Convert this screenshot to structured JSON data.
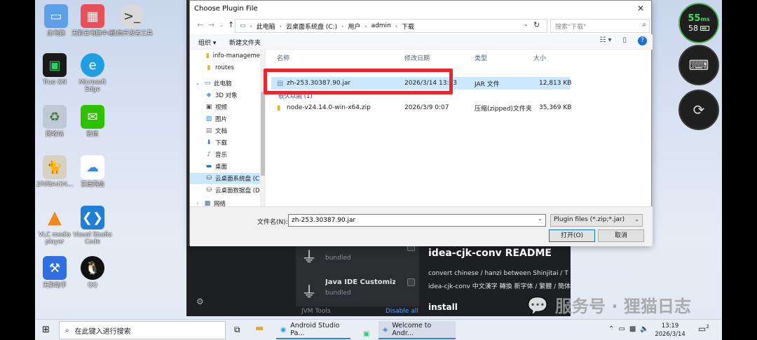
{
  "desktop_icons": [
    {
      "label": "此电脑",
      "icon": "computer-icon",
      "color": "#5da0e8"
    },
    {
      "label": "无影云电脑中心",
      "icon": "cloud-pc-icon",
      "color": "#e8505b"
    },
    {
      "label": "微信开发者工具",
      "icon": "wechat-devtools-icon",
      "color": "#d9d9d9"
    },
    {
      "label": "True ON",
      "icon": "true-on-icon",
      "color": "#1a1a1a"
    },
    {
      "label": "Microsoft Edge",
      "icon": "edge-icon",
      "color": "#1f9ee0"
    },
    {
      "label": "回收站",
      "icon": "recycle-bin-icon",
      "color": "#bfc9d6"
    },
    {
      "label": "微信",
      "icon": "wechat-icon",
      "color": "#2dc100"
    },
    {
      "label": "2f4f8A434...",
      "icon": "cat-image-icon",
      "color": "#d8d0c0"
    },
    {
      "label": "百度网盘",
      "icon": "baidu-netdisk-icon",
      "color": "#ffffff"
    },
    {
      "label": "VLC media player",
      "icon": "vlc-icon",
      "color": "#f08a1c"
    },
    {
      "label": "Visual Studio Code",
      "icon": "vscode-icon",
      "color": "#1f7fd4"
    },
    {
      "label": "无影助手",
      "icon": "wuying-assistant-icon",
      "color": "#2f6fe0"
    },
    {
      "label": "QQ",
      "icon": "qq-icon",
      "color": "#111111"
    }
  ],
  "overlay": {
    "latency": "55",
    "latency_unit": "ms",
    "battery": "58"
  },
  "ide": {
    "plugins": [
      {
        "name": "",
        "badge": "bundled"
      },
      {
        "name": "Java IDE Customizati...",
        "badge": "bundled"
      }
    ],
    "readme_title": "idea-cjk-conv README",
    "readme_line1": "convert chinese / hanzi between Shinjitai / T",
    "readme_line2": "idea-cjk-conv 中文漢字 轉換 新字体 / 繁體 / 簡体",
    "install_heading": "install",
    "group_label": "JVM Tools",
    "disable_all": "Disable all"
  },
  "dialog": {
    "title": "Choose Plugin File",
    "breadcrumb": [
      "此电脑",
      "云桌面系统盘 (C:)",
      "用户",
      "admin",
      "下载"
    ],
    "search_placeholder": "搜索\"下载\"",
    "toolbar": {
      "organize": "组织 ▾",
      "new_folder": "新建文件夹"
    },
    "nav": [
      {
        "label": "info-manageme",
        "icon": "folder-icon",
        "indent": 1
      },
      {
        "label": "routes",
        "icon": "folder-icon",
        "indent": 1
      },
      {
        "label": "此电脑",
        "icon": "computer-icon",
        "indent": 0
      },
      {
        "label": "3D 对象",
        "icon": "3d-objects-icon",
        "indent": 1
      },
      {
        "label": "视频",
        "icon": "video-icon",
        "indent": 1
      },
      {
        "label": "图片",
        "icon": "pictures-icon",
        "indent": 1
      },
      {
        "label": "文档",
        "icon": "documents-icon",
        "indent": 1
      },
      {
        "label": "下载",
        "icon": "downloads-icon",
        "indent": 1
      },
      {
        "label": "音乐",
        "icon": "music-icon",
        "indent": 1
      },
      {
        "label": "桌面",
        "icon": "desktop-icon",
        "indent": 1
      },
      {
        "label": "云桌面系统盘 (C",
        "icon": "drive-icon",
        "indent": 1,
        "selected": true
      },
      {
        "label": "云桌面数据盘 (D",
        "icon": "drive-icon",
        "indent": 1
      },
      {
        "label": "网络",
        "icon": "network-icon",
        "indent": 0
      }
    ],
    "columns": {
      "name": "名称",
      "date": "修改日期",
      "type": "类型",
      "size": "大小"
    },
    "groups": [
      "",
      "很久以前 (1)"
    ],
    "files": [
      {
        "name": "zh-253.30387.90.jar",
        "date": "2026/3/14 13:13",
        "type": "JAR 文件",
        "size": "12,813 KB",
        "selected": true,
        "icon": "jar-file-icon"
      },
      {
        "name": "node-v24.14.0-win-x64.zip",
        "date": "2026/3/9 0:07",
        "type": "压缩(zipped)文件夹",
        "size": "35,369 KB",
        "selected": false,
        "icon": "zip-folder-icon"
      }
    ],
    "filename_label": "文件名(N):",
    "filename_value": "zh-253.30387.90.jar",
    "filetype_value": "Plugin files (*.zip;*.jar)",
    "open_button": "打开(O)",
    "cancel_button": "取消"
  },
  "taskbar": {
    "search_placeholder": "在此键入进行搜索",
    "apps": [
      {
        "label": "Android Studio Pa..."
      },
      {
        "label": "Welcome to Andr..."
      }
    ],
    "time": "13:19",
    "date": "2026/3/14",
    "notifications": "2"
  },
  "watermark": {
    "text": "服务号 · 狸猫日志"
  },
  "colors": {
    "accent": "#0078d7",
    "highlight": "#e8262d",
    "selection": "#cce8ff"
  }
}
